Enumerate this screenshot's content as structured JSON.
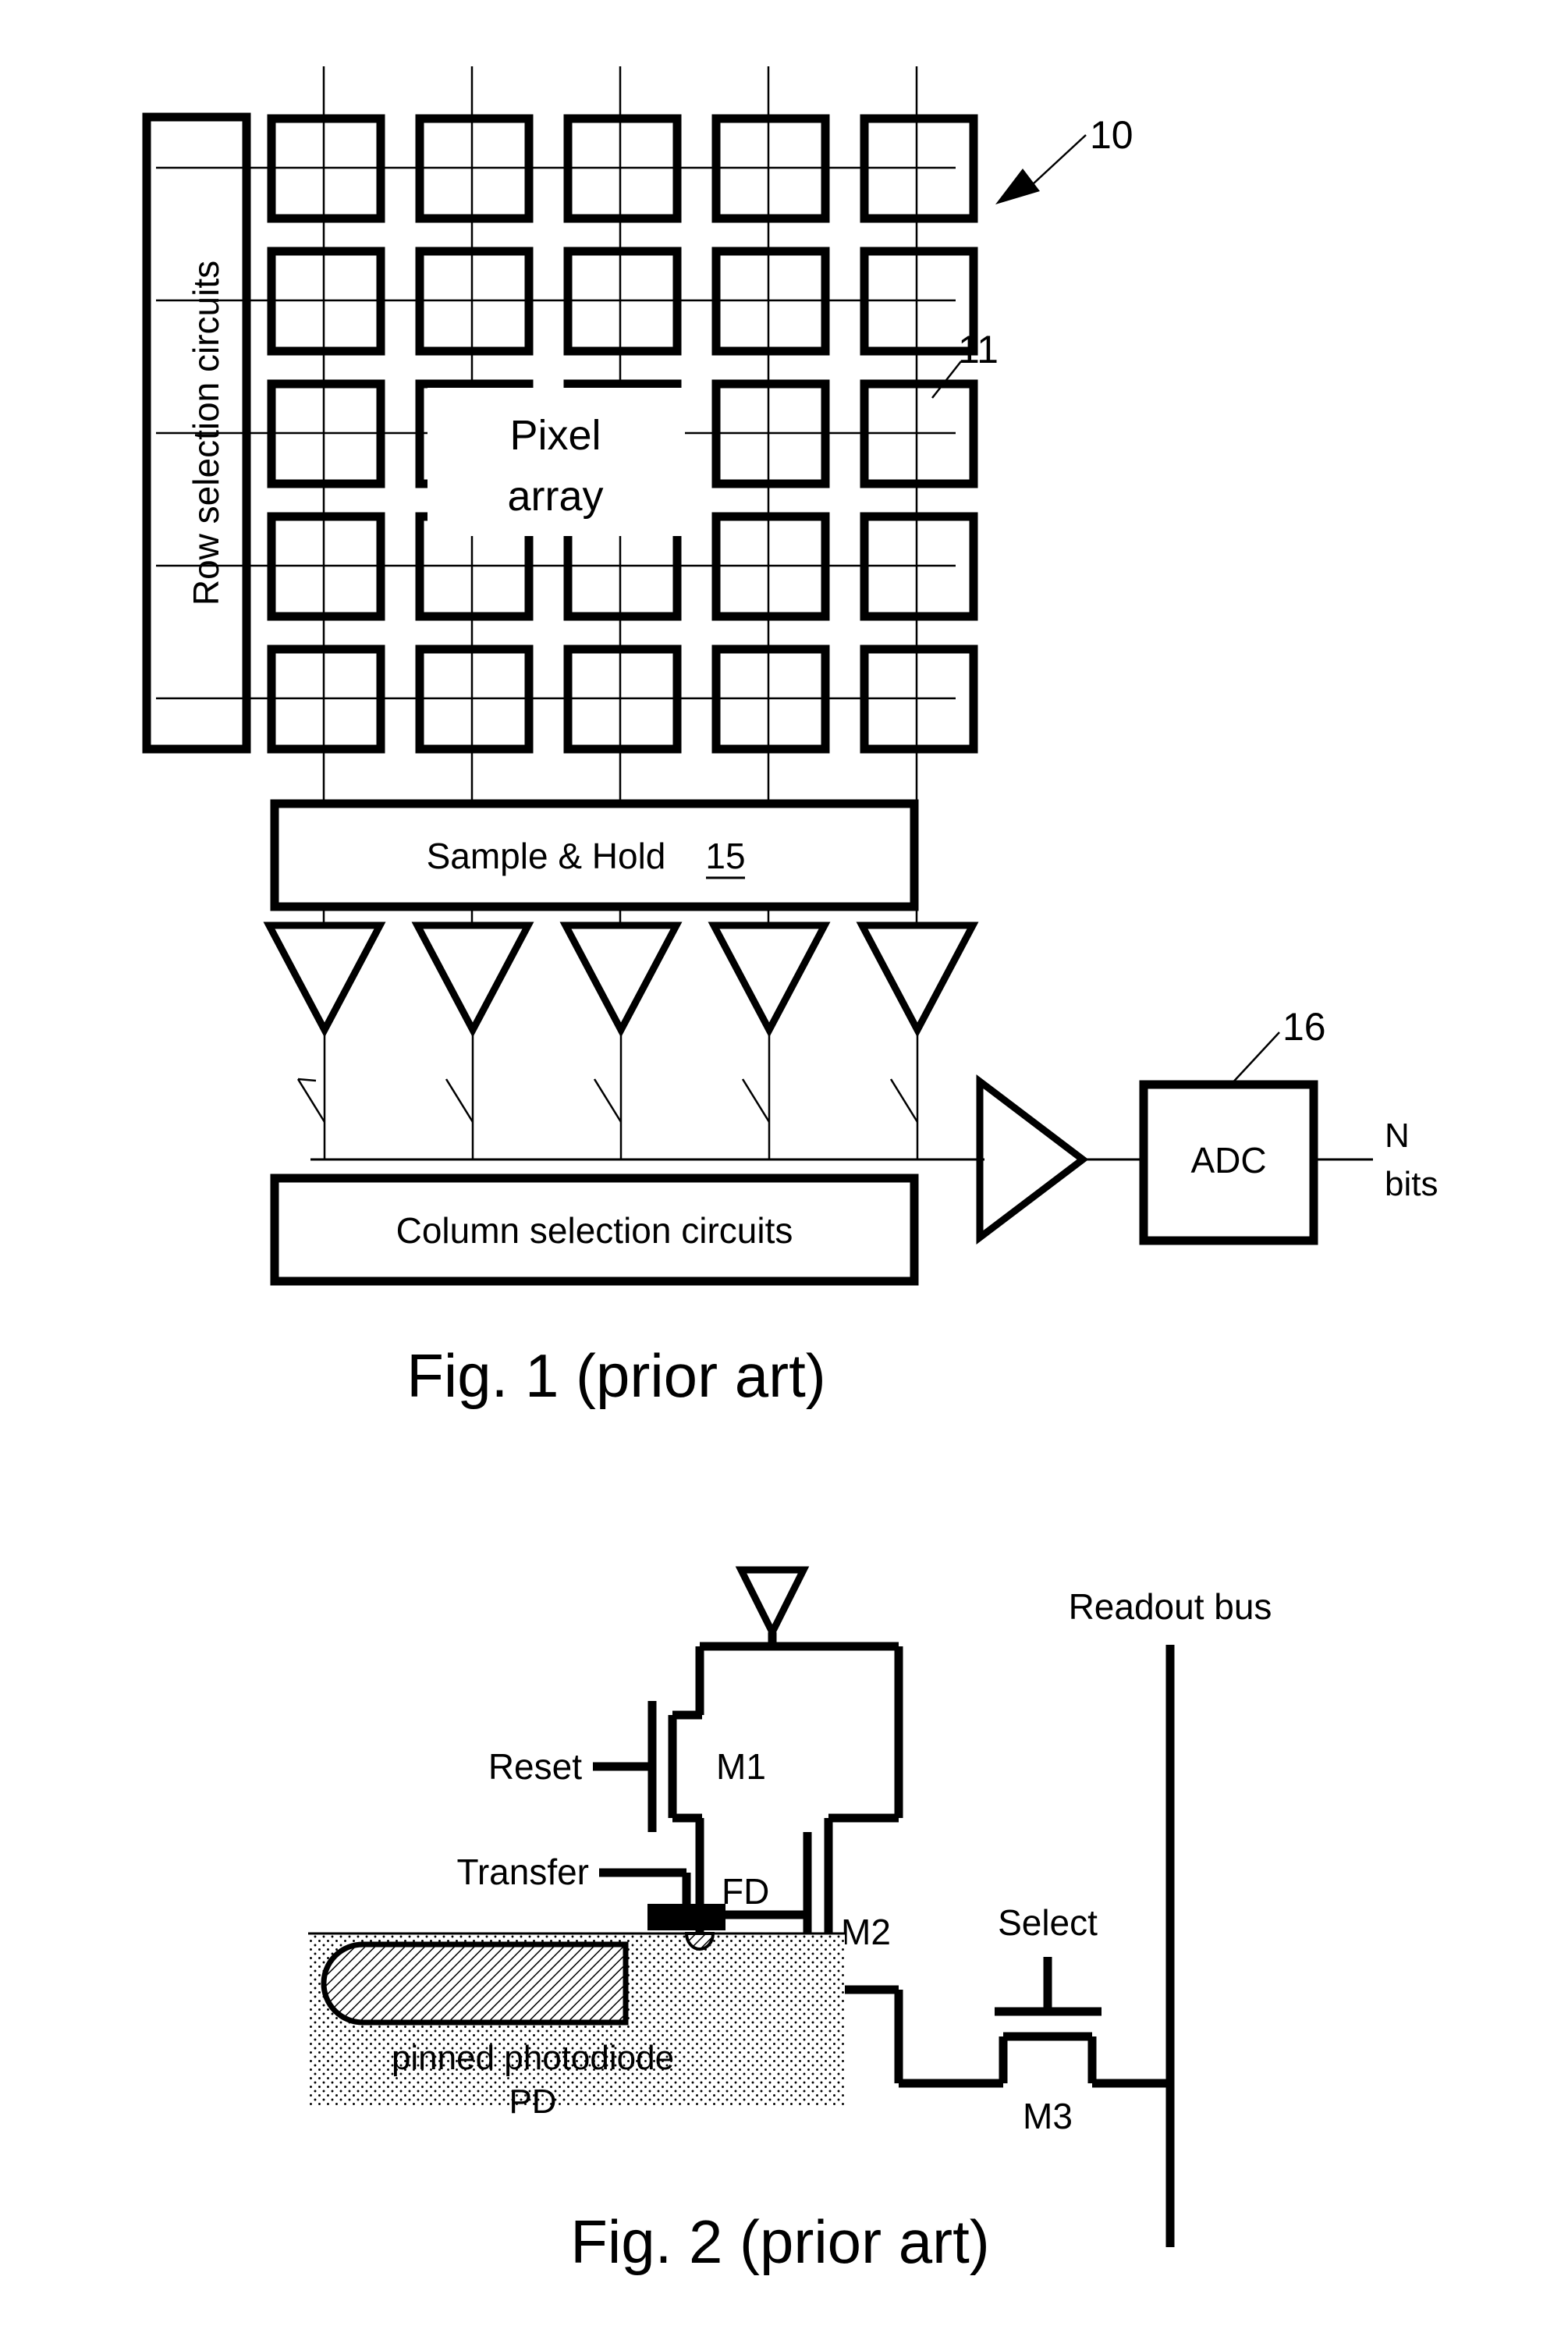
{
  "document": {
    "type": "patent-figure-sheet",
    "background_color": "#ffffff",
    "ink_color": "#000000"
  },
  "figure1": {
    "caption": "Fig. 1 (prior art)",
    "row_selection_label": "Row selection circuits",
    "pixel_array_label_line1": "Pixel",
    "pixel_array_label_line2": "array",
    "sample_hold_label": "Sample & Hold",
    "sample_hold_ref": "15",
    "column_selection_label": "Column selection circuits",
    "adc_label": "ADC",
    "adc_ref": "16",
    "output_label_line1": "N",
    "output_label_line2": "bits",
    "ref_sensor": "10",
    "ref_pixel": "11",
    "array": {
      "rows": 5,
      "columns": 5,
      "amplifiers": 5,
      "switches": 5
    }
  },
  "figure2": {
    "caption": "Fig. 2 (prior art)",
    "reset_label": "Reset",
    "transfer_label": "Transfer",
    "select_label": "Select",
    "readout_bus_label": "Readout bus",
    "m1_label": "M1",
    "m2_label": "M2",
    "m3_label": "M3",
    "fd_label": "FD",
    "photodiode_label_line1": "pinned photodiode",
    "photodiode_label_line2": "PD"
  }
}
